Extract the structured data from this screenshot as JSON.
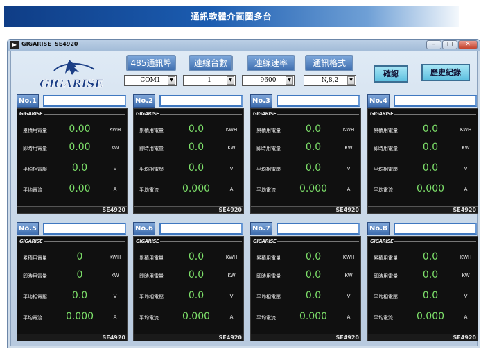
{
  "banner": {
    "title": "通訊軟體介面圖多台"
  },
  "window": {
    "app_name": "GIGARISE",
    "model": "SE4920",
    "controls": [
      "–",
      "□",
      "✕"
    ]
  },
  "logo": {
    "text": "GIGARISE"
  },
  "toolbar": {
    "buttons": [
      "485通訊埠",
      "連線台數",
      "連線速率",
      "通訊格式"
    ],
    "selects": [
      "COM1",
      "1",
      "9600",
      "N,8,2"
    ],
    "confirm_label": "確認",
    "history_label": "歷史紀錄"
  },
  "panels": [
    {
      "no": "No.1",
      "brand": "GIGARISE",
      "rows": [
        {
          "label": "累積用電量",
          "value": "0.00",
          "unit": "KWH"
        },
        {
          "label": "即時用電量",
          "value": "0.00",
          "unit": "KW"
        },
        {
          "label": "平均相電壓",
          "value": "0.0",
          "unit": "V"
        },
        {
          "label": "平均電流",
          "value": "0.00",
          "unit": "A"
        }
      ],
      "model": "SE4920"
    },
    {
      "no": "No.2",
      "brand": "GIGARISE",
      "rows": [
        {
          "label": "累積用電量",
          "value": "0.0",
          "unit": "KWH"
        },
        {
          "label": "即時用電量",
          "value": "0.0",
          "unit": "KW"
        },
        {
          "label": "平均相電壓",
          "value": "0.0",
          "unit": "V"
        },
        {
          "label": "平均電流",
          "value": "0.000",
          "unit": "A"
        }
      ],
      "model": "SE4920"
    },
    {
      "no": "No.3",
      "brand": "GIGARISE",
      "rows": [
        {
          "label": "累積用電量",
          "value": "0.0",
          "unit": "KWH"
        },
        {
          "label": "即時用電量",
          "value": "0.0",
          "unit": "KW"
        },
        {
          "label": "平均相電壓",
          "value": "0.0",
          "unit": "V"
        },
        {
          "label": "平均電流",
          "value": "0.000",
          "unit": "A"
        }
      ],
      "model": "SE4920"
    },
    {
      "no": "No.4",
      "brand": "GIGARISE",
      "rows": [
        {
          "label": "累積用電量",
          "value": "0.0",
          "unit": "KWH"
        },
        {
          "label": "即時用電量",
          "value": "0.0",
          "unit": "KW"
        },
        {
          "label": "平均相電壓",
          "value": "0.0",
          "unit": "V"
        },
        {
          "label": "平均電流",
          "value": "0.000",
          "unit": "A"
        }
      ],
      "model": "SE4920"
    },
    {
      "no": "No.5",
      "brand": "GIGARISE",
      "rows": [
        {
          "label": "累積用電量",
          "value": "0",
          "unit": "KWH"
        },
        {
          "label": "即時用電量",
          "value": "0",
          "unit": "KW"
        },
        {
          "label": "平均相電壓",
          "value": "0.0",
          "unit": "V"
        },
        {
          "label": "平均電流",
          "value": "0.000",
          "unit": "A"
        }
      ],
      "model": "SE4920"
    },
    {
      "no": "No.6",
      "brand": "GIGARISE",
      "rows": [
        {
          "label": "累積用電量",
          "value": "0.0",
          "unit": "KWH"
        },
        {
          "label": "即時用電量",
          "value": "0.0",
          "unit": "KW"
        },
        {
          "label": "平均相電壓",
          "value": "0.0",
          "unit": "V"
        },
        {
          "label": "平均電流",
          "value": "0.000",
          "unit": "A"
        }
      ],
      "model": "SE4920"
    },
    {
      "no": "No.7",
      "brand": "GIGARISE",
      "rows": [
        {
          "label": "累積用電量",
          "value": "0.0",
          "unit": "KWH"
        },
        {
          "label": "即時用電量",
          "value": "0.0",
          "unit": "KW"
        },
        {
          "label": "平均相電壓",
          "value": "0.0",
          "unit": "V"
        },
        {
          "label": "平均電流",
          "value": "0.000",
          "unit": "A"
        }
      ],
      "model": "SE4920"
    },
    {
      "no": "No.8",
      "brand": "GIGARISE",
      "rows": [
        {
          "label": "累積用電量",
          "value": "0.0",
          "unit": "KWH"
        },
        {
          "label": "即時用電量",
          "value": "0.0",
          "unit": "KW"
        },
        {
          "label": "平均相電壓",
          "value": "0.0",
          "unit": "V"
        },
        {
          "label": "平均電流",
          "value": "0.000",
          "unit": "A"
        }
      ],
      "model": "SE4920"
    }
  ]
}
